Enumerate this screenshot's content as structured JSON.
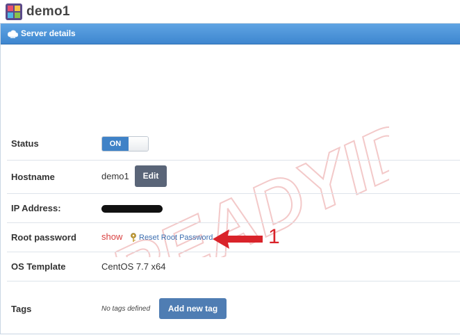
{
  "header": {
    "title": "demo1",
    "logo_icon": "server-logo-icon"
  },
  "panel": {
    "title": "Server details",
    "icon": "cloud-icon",
    "bar_color": "#4a90d9"
  },
  "watermark": "READYIDC",
  "rows": {
    "status": {
      "label": "Status",
      "toggle_on": "ON"
    },
    "hostname": {
      "label": "Hostname",
      "value": "demo1",
      "edit_label": "Edit"
    },
    "ip": {
      "label": "IP Address:"
    },
    "root_password": {
      "label": "Root password",
      "show_label": "show",
      "reset_label": "Reset Root Password"
    },
    "os": {
      "label": "OS Template",
      "value": "CentOS 7.7 x64"
    },
    "tags": {
      "label": "Tags",
      "empty_text": "No tags defined",
      "add_label": "Add new tag"
    }
  },
  "annotation": {
    "number": "1",
    "color": "#d9232a"
  }
}
